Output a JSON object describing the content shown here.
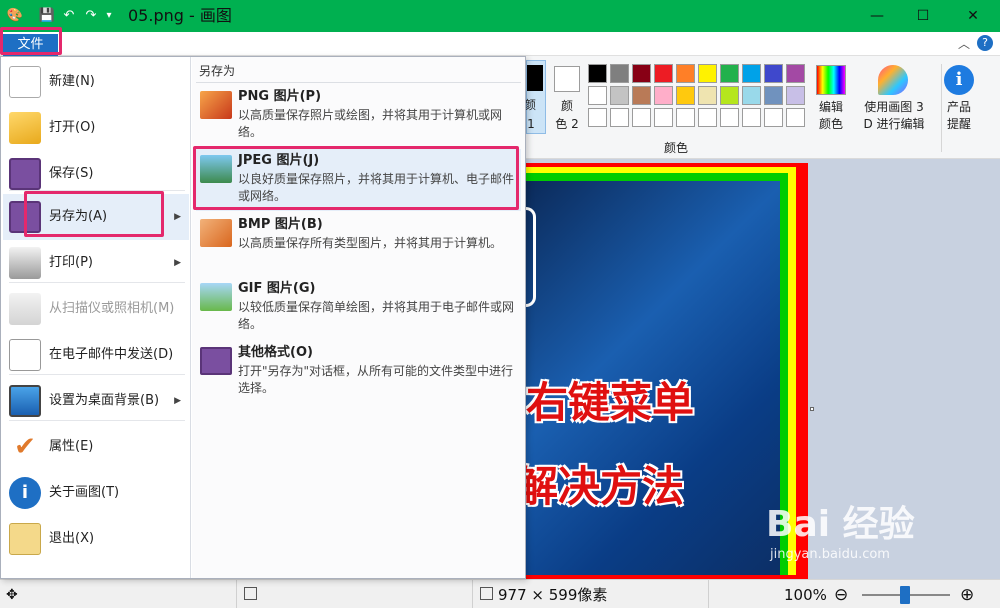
{
  "window": {
    "title": "05.png - 画图",
    "minimize": "—",
    "maximize": "☐",
    "close": "✕"
  },
  "quick_access": {
    "save": "💾",
    "undo": "↶",
    "redo": "↷",
    "customize": "▾"
  },
  "tabs": {
    "file": "文件",
    "collapse": "︿",
    "help": "?"
  },
  "file_menu": {
    "items": [
      {
        "label": "新建(N)",
        "icon": "new-page-icon"
      },
      {
        "label": "打开(O)",
        "icon": "open-folder-icon"
      },
      {
        "label": "保存(S)",
        "icon": "floppy-disk-icon"
      },
      {
        "label": "另存为(A)",
        "icon": "save-as-icon",
        "submenu": true
      },
      {
        "label": "打印(P)",
        "icon": "printer-icon",
        "submenu": true
      },
      {
        "label": "从扫描仪或照相机(M)",
        "icon": "scanner-icon",
        "disabled": true
      },
      {
        "label": "在电子邮件中发送(D)",
        "icon": "envelope-icon"
      },
      {
        "label": "设置为桌面背景(B)",
        "icon": "desktop-icon",
        "submenu": true
      },
      {
        "label": "属性(E)",
        "icon": "checkmark-icon"
      },
      {
        "label": "关于画图(T)",
        "icon": "info-icon"
      },
      {
        "label": "退出(X)",
        "icon": "exit-icon"
      }
    ],
    "submenu_arrow": "▶"
  },
  "save_as": {
    "header": "另存为",
    "formats": [
      {
        "title": "PNG 图片(P)",
        "desc": "以高质量保存照片或绘图，并将其用于计算机或网络。",
        "icon": "png-image-icon"
      },
      {
        "title": "JPEG 图片(J)",
        "desc": "以良好质量保存照片，并将其用于计算机、电子邮件或网络。",
        "icon": "jpeg-image-icon"
      },
      {
        "title": "BMP 图片(B)",
        "desc": "以高质量保存所有类型图片，并将其用于计算机。",
        "icon": "bmp-image-icon"
      },
      {
        "title": "GIF 图片(G)",
        "desc": "以较低质量保存简单绘图，并将其用于电子邮件或网络。",
        "icon": "gif-image-icon"
      },
      {
        "title": "其他格式(O)",
        "desc": "打开\"另存为\"对话框，从所有可能的文件类型中进行选择。",
        "icon": "other-formats-icon"
      }
    ]
  },
  "ribbon": {
    "color1_label_a": "颜",
    "color1_label_b": "1",
    "color2_label_a": "颜",
    "color2_label_b": "色 2",
    "colors_group": "颜色",
    "edit_colors_a": "编辑",
    "edit_colors_b": "颜色",
    "paint3d_a": "使用画图 3",
    "paint3d_b": "D 进行编辑",
    "product_a": "产品",
    "product_b": "提醒",
    "palette_row1": [
      "#000000",
      "#7f7f7f",
      "#880015",
      "#ed1c24",
      "#ff7f27",
      "#fff200",
      "#22b14c",
      "#00a2e8",
      "#3f48cc",
      "#a349a4"
    ],
    "palette_row2": [
      "#ffffff",
      "#c3c3c3",
      "#b97a57",
      "#ffaec9",
      "#ffc90e",
      "#efe4b0",
      "#b5e61d",
      "#99d9ea",
      "#7092be",
      "#c8bfe7"
    ],
    "palette_row3": [
      "#ffffff",
      "#ffffff",
      "#ffffff",
      "#ffffff",
      "#ffffff",
      "#ffffff",
      "#ffffff",
      "#ffffff",
      "#ffffff",
      "#ffffff"
    ]
  },
  "canvas_text": {
    "line1": "右键菜单",
    "line2": "解决方法"
  },
  "watermark": {
    "line1": "Bai 经验",
    "line2": "jingyan.baidu.com"
  },
  "status": {
    "dimensions": "977 × 599像素",
    "zoom": "100%",
    "zoom_out": "⊖",
    "zoom_in": "⊕"
  },
  "colors": {
    "title_bar": "#00b050",
    "file_tab": "#1e6fc4",
    "highlight": "#e4286c"
  }
}
